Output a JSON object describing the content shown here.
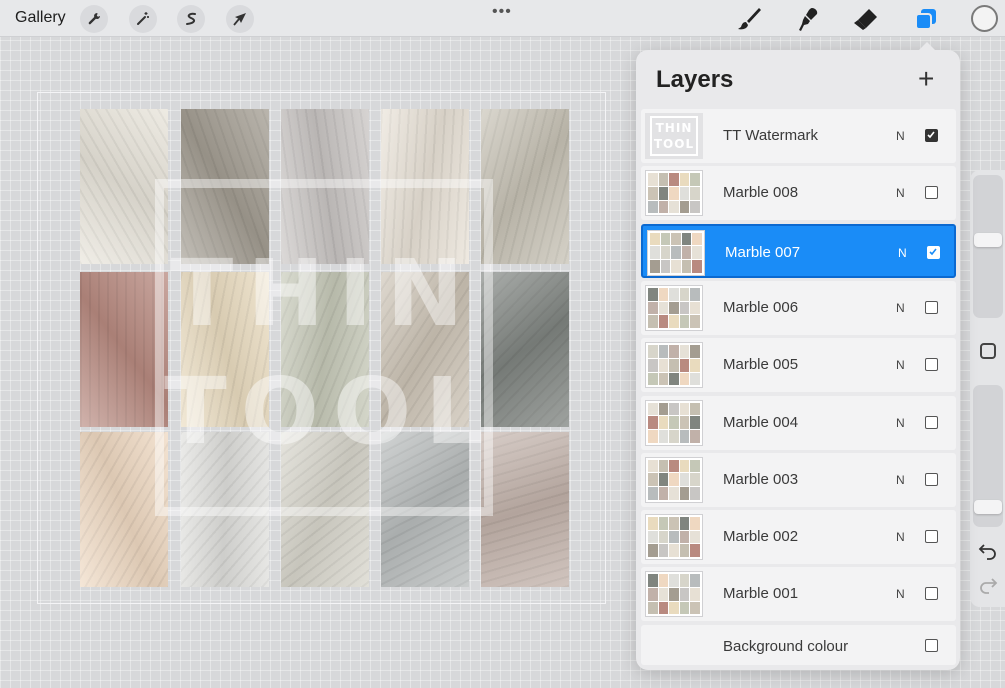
{
  "toolbar": {
    "gallery_label": "Gallery",
    "left_tools": [
      "wrench-icon",
      "magic-wand-icon",
      "selection-icon",
      "transform-arrow-icon"
    ],
    "right_tools": [
      "brush-icon",
      "smudge-icon",
      "eraser-icon",
      "layers-icon"
    ],
    "more_dots": "•••",
    "current_color": "#f3f3f3",
    "accent": "#1a8cf7"
  },
  "canvas": {
    "watermark_line1": "THIN",
    "watermark_line2": "TOOL",
    "tiles": [
      [
        "#e8e4da",
        "#a39d92",
        "#c9c5c3",
        "#e9e2d7",
        "#c7c2b5"
      ],
      [
        "#b88a80",
        "#eadcc0",
        "#c6c9b8",
        "#cdc4b6",
        "#7f8480"
      ],
      [
        "#efd9c2",
        "#dfdfdc",
        "#d8d6cc",
        "#b8bcbc",
        "#c2b2aa"
      ]
    ]
  },
  "layers": {
    "title": "Layers",
    "add_label": "+",
    "items": [
      {
        "name": "TT Watermark",
        "mode": "N",
        "visible": true,
        "selected": false
      },
      {
        "name": "Marble 008",
        "mode": "N",
        "visible": false,
        "selected": false
      },
      {
        "name": "Marble 007",
        "mode": "N",
        "visible": true,
        "selected": true
      },
      {
        "name": "Marble 006",
        "mode": "N",
        "visible": false,
        "selected": false
      },
      {
        "name": "Marble 005",
        "mode": "N",
        "visible": false,
        "selected": false
      },
      {
        "name": "Marble 004",
        "mode": "N",
        "visible": false,
        "selected": false
      },
      {
        "name": "Marble 003",
        "mode": "N",
        "visible": false,
        "selected": false
      },
      {
        "name": "Marble 002",
        "mode": "N",
        "visible": false,
        "selected": false
      },
      {
        "name": "Marble 001",
        "mode": "N",
        "visible": false,
        "selected": false
      }
    ],
    "watermark_thumb_line1": "THIN",
    "watermark_thumb_line2": "TOOL",
    "background_label": "Background colour",
    "background_visible": false
  },
  "sidebar": {
    "brush_size_level": 0.55,
    "opacity_level": 0.1
  }
}
